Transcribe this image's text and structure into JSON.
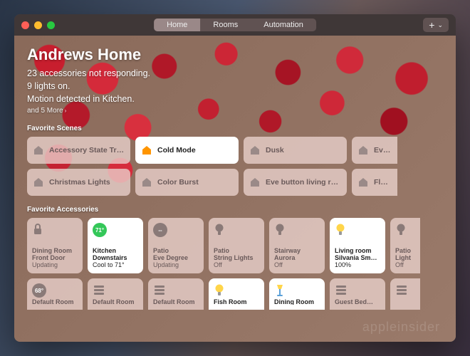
{
  "tabs": {
    "home": "Home",
    "rooms": "Rooms",
    "automation": "Automation"
  },
  "header": {
    "title": "Andrews Home",
    "status1": "23 accessories not responding.",
    "status2": "9 lights on.",
    "status3": "Motion detected in Kitchen.",
    "more": "and 5 More"
  },
  "sections": {
    "scenes": "Favorite Scenes",
    "accessories": "Favorite Accessories"
  },
  "scenes_row1": [
    {
      "label": "Accessory State Trigge…",
      "active": false
    },
    {
      "label": "Cold Mode",
      "active": true
    },
    {
      "label": "Dusk",
      "active": false
    },
    {
      "label": "Eve button l…",
      "active": false
    }
  ],
  "scenes_row2": [
    {
      "label": "Christmas Lights",
      "active": false
    },
    {
      "label": "Color Burst",
      "active": false
    },
    {
      "label": "Eve button living room li…",
      "active": false
    },
    {
      "label": "Flame",
      "active": false
    }
  ],
  "acc_row1": [
    {
      "icon": "lock",
      "room": "Dining Room",
      "name": "Front Door",
      "status": "Updating",
      "on": false
    },
    {
      "icon": "temp",
      "badge": "71°",
      "room": "Kitchen",
      "name": "Downstairs",
      "status": "Cool to 71°",
      "on": true
    },
    {
      "icon": "temp-off",
      "room": "Patio",
      "name": "Eve Degree",
      "status": "Updating",
      "on": false
    },
    {
      "icon": "bulb",
      "room": "Patio",
      "name": "String Lights",
      "status": "Off",
      "on": false
    },
    {
      "icon": "bulb",
      "room": "Stairway",
      "name": "Aurora",
      "status": "Off",
      "on": false
    },
    {
      "icon": "bulb-on",
      "room": "Living room",
      "name": "Silvania Sm…",
      "status": "100%",
      "on": true
    },
    {
      "icon": "bulb",
      "room": "Patio",
      "name": "Light",
      "status": "Off",
      "on": false
    }
  ],
  "acc_row2": [
    {
      "icon": "temp-off",
      "badge": "68°",
      "room": "Default Room",
      "name": "",
      "status": "",
      "on": false
    },
    {
      "icon": "blinds",
      "room": "Default Room",
      "name": "",
      "status": "",
      "on": false
    },
    {
      "icon": "blinds",
      "room": "Default Room",
      "name": "",
      "status": "",
      "on": false
    },
    {
      "icon": "bulb-on2",
      "room": "Fish Room",
      "name": "",
      "status": "",
      "on": true
    },
    {
      "icon": "lamp-on",
      "room": "Dining Room",
      "name": "",
      "status": "",
      "on": true
    },
    {
      "icon": "blinds",
      "room": "Guest Bed…",
      "name": "",
      "status": "",
      "on": false
    },
    {
      "icon": "blinds",
      "room": "",
      "name": "",
      "status": "",
      "on": false
    }
  ],
  "watermark": "appleinsider"
}
